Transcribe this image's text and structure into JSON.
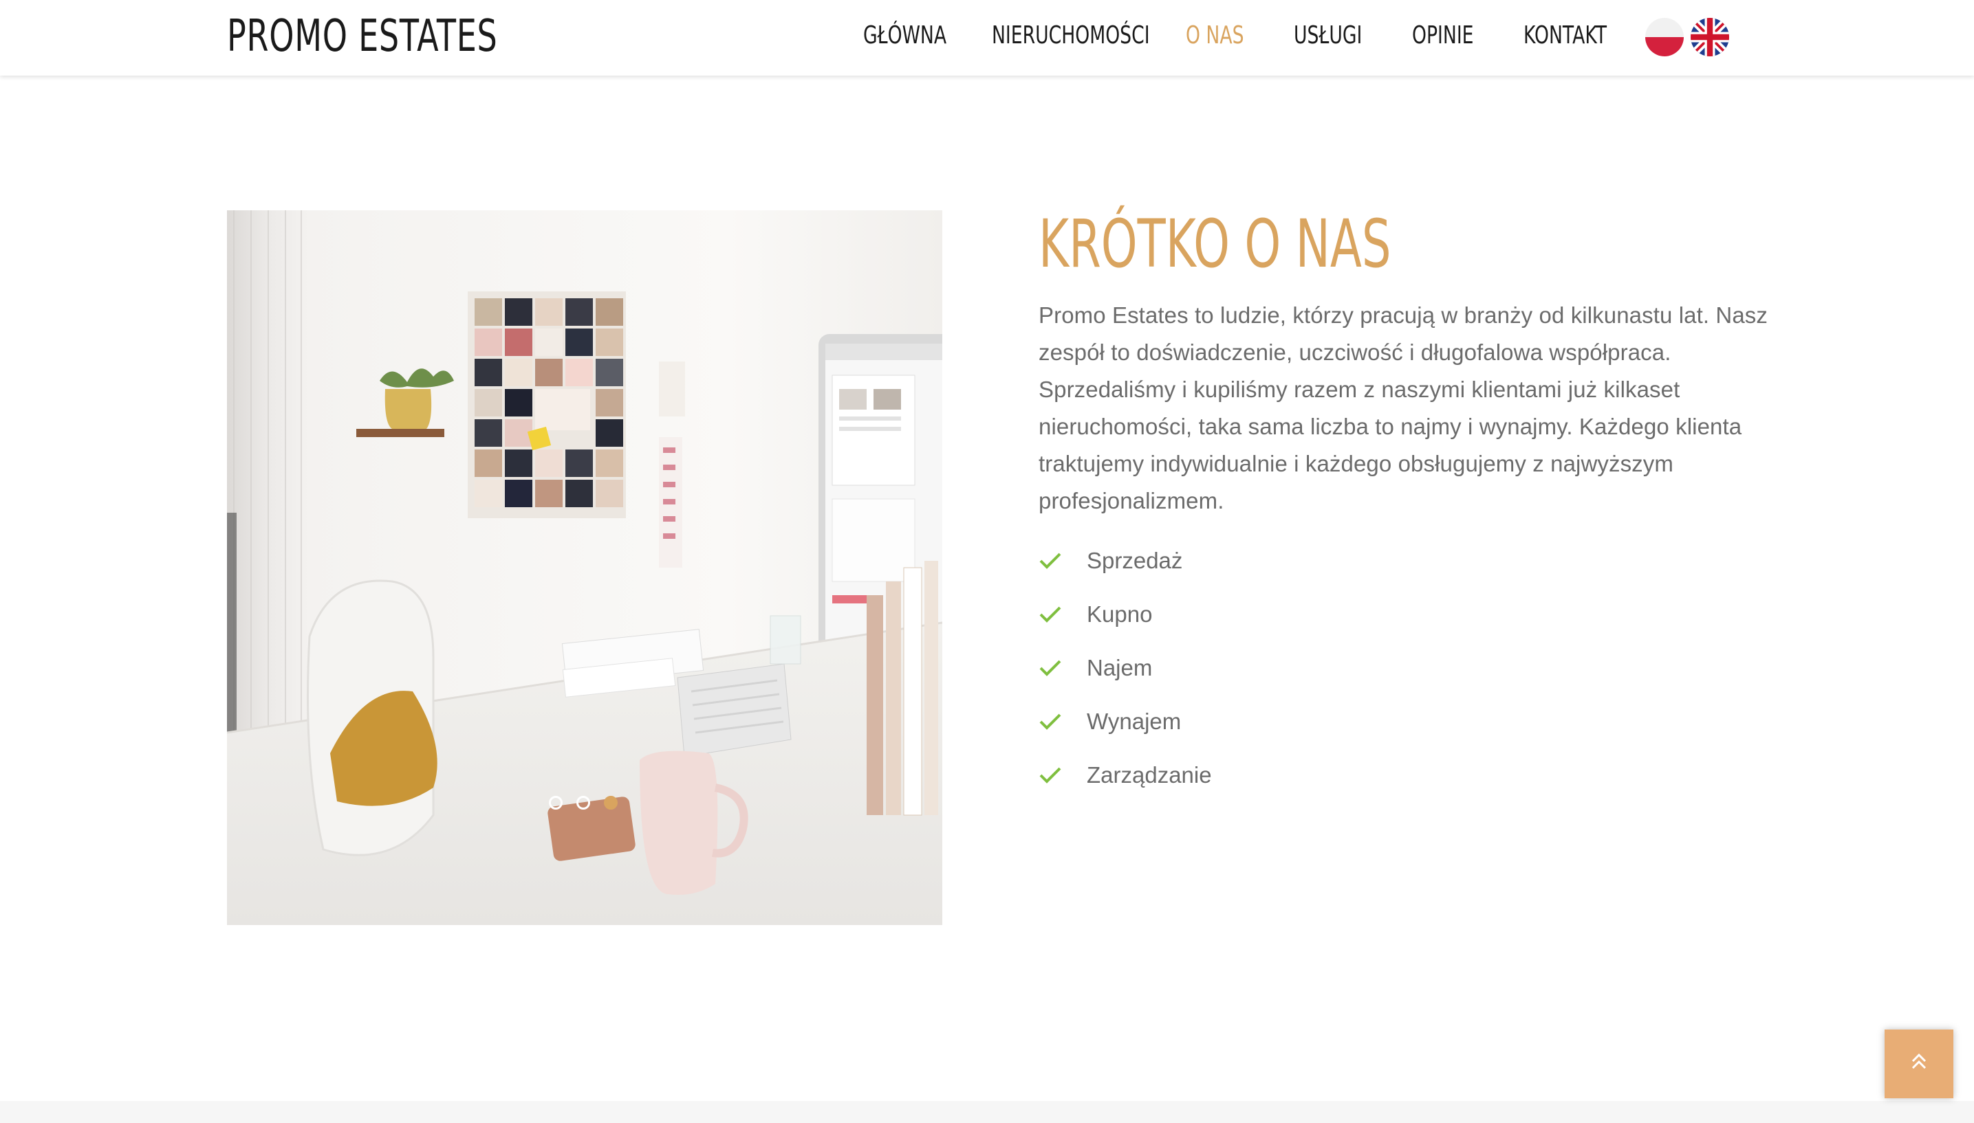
{
  "header": {
    "brand": "PROMO ESTATES",
    "nav": [
      {
        "label": "GŁÓWNA",
        "active": false
      },
      {
        "label": "NIERUCHOMOŚCI",
        "active": false
      },
      {
        "label": "O NAS",
        "active": true
      },
      {
        "label": "USŁUGI",
        "active": false
      },
      {
        "label": "OPINIE",
        "active": false
      },
      {
        "label": "KONTAKT",
        "active": false
      }
    ],
    "languages": [
      {
        "icon": "flag-poland-icon"
      },
      {
        "icon": "flag-uk-icon"
      }
    ]
  },
  "about": {
    "title": "KRÓTKO O NAS",
    "paragraph_lines": [
      "Promo Estates to ludzie, którzy pracują w branży od kilkunastu lat. Nasz",
      "zespół to doświadczenie, uczciwość i długofalowa współpraca.",
      "Sprzedaliśmy i kupiliśmy razem z naszymi klientami już kilkaset",
      "nieruchomości, taka sama liczba to najmy i wynajmy. Każdego klienta",
      "traktujemy indywidualnie i każdego obsługujemy z najwyższym",
      "profesjonalizmem."
    ],
    "services": [
      "Sprzedaż",
      "Kupno",
      "Najem",
      "Wynajem",
      "Zarządzanie"
    ]
  },
  "slider": {
    "slide_count": 3,
    "active_slide": 3
  },
  "scroll_top_icon": "double-chevron-up-icon",
  "colors": {
    "accent": "#d9a45f",
    "check": "#7fbf3f",
    "scroll_button": "#e8ad75",
    "text": "#6b6b6b"
  }
}
